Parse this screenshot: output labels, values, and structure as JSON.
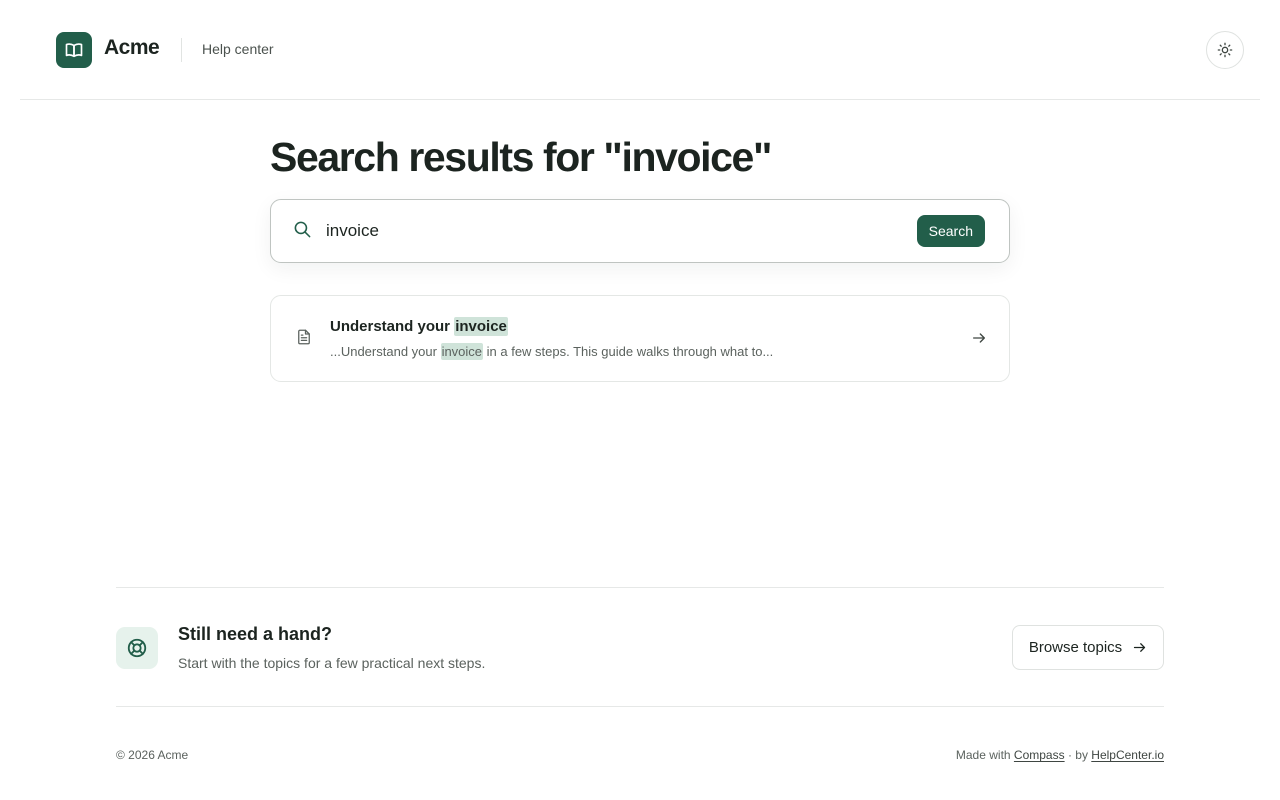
{
  "header": {
    "brand": "Acme",
    "help_link": "Help center",
    "logo_icon": "book-open-icon",
    "theme_icon": "sun-icon"
  },
  "main": {
    "title": "Search results for \"invoice\"",
    "search": {
      "value": "invoice",
      "button_label": "Search",
      "icon": "search-icon"
    },
    "results": [
      {
        "icon": "document-icon",
        "title_prefix": "Understand your ",
        "title_highlight": "invoice",
        "snippet_prefix": "...Understand your ",
        "snippet_highlight": "invoice",
        "snippet_suffix": " in a few steps. This guide walks through what to...",
        "arrow_icon": "arrow-right-icon"
      }
    ]
  },
  "help_band": {
    "icon": "lifebuoy-icon",
    "title": "Still need a hand?",
    "subtitle": "Start with the topics for a few practical next steps.",
    "button_label": "Browse topics",
    "button_icon": "arrow-right-icon"
  },
  "footer": {
    "copyright": "© 2026 Acme",
    "made_with_prefix": "Made with ",
    "made_with_link": "Compass",
    "made_with_sep": " · by ",
    "by_link": "HelpCenter.io"
  },
  "colors": {
    "brand": "#225e4a",
    "highlight": "#cfe3d9",
    "icon_tile_bg": "#e6f2ec"
  }
}
